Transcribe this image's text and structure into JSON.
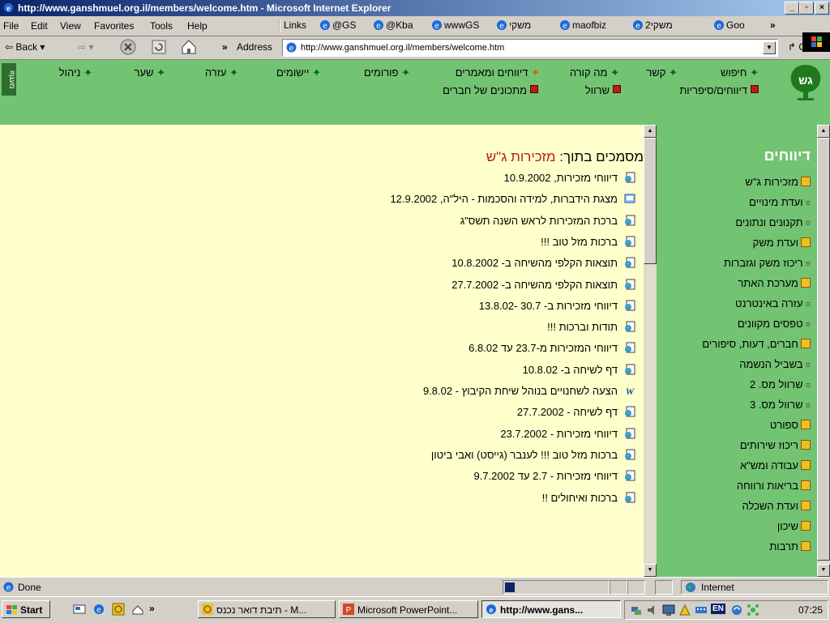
{
  "window": {
    "title": "http://www.ganshmuel.org.il/members/welcome.htm - Microsoft Internet Explorer",
    "controls": [
      "_",
      "▫",
      "×"
    ]
  },
  "menu": {
    "items": [
      "File",
      "Edit",
      "View",
      "Favorites",
      "Tools",
      "Help"
    ],
    "links_label": "Links",
    "links": [
      "@GS",
      "@Kba",
      "wwwGS",
      "משקי",
      "maofbiz",
      "2משקי",
      "Goo"
    ],
    "more": "»"
  },
  "navbar": {
    "back": "Back",
    "more": "»",
    "address_label": "Address",
    "url": "http://www.ganshmuel.org.il/members/welcome.htm",
    "go": "Go"
  },
  "site_nav": {
    "hash_label": "#מעגן",
    "row1": [
      "חיפוש",
      "קשר",
      "מה קורה",
      "דיווחים ומאמרים",
      "פורומים",
      "יישומים",
      "עזרה",
      "שער",
      "ניהול"
    ],
    "row2": [
      "דיווחים/סיפריות",
      "שרוול",
      "מתכונים של חברים"
    ]
  },
  "sidebar": {
    "title": "דיווחים",
    "items": [
      {
        "label": "מזכירות ג\"ש",
        "type": "folder"
      },
      {
        "label": "ועדת מינויים",
        "type": "sub"
      },
      {
        "label": "תקנונים ונתונים",
        "type": "sub"
      },
      {
        "label": "ועדת משק",
        "type": "folder"
      },
      {
        "label": "ריכוז משק וגזברות",
        "type": "sub"
      },
      {
        "label": "מערכת האתר",
        "type": "folder"
      },
      {
        "label": "עזרה באינטרנט",
        "type": "sub"
      },
      {
        "label": "טפסים מקוונים",
        "type": "sub"
      },
      {
        "label": "חברים, דעות, סיפורים",
        "type": "folder"
      },
      {
        "label": "בשביל הנשמה",
        "type": "sub"
      },
      {
        "label": "שרוול מס. 2",
        "type": "sub"
      },
      {
        "label": "שרוול מס. 3",
        "type": "sub"
      },
      {
        "label": "ספורט",
        "type": "folder"
      },
      {
        "label": "ריכוז שירותים",
        "type": "folder"
      },
      {
        "label": "עבודה ומש\"א",
        "type": "folder"
      },
      {
        "label": "בריאות ורווחה",
        "type": "folder"
      },
      {
        "label": "ועדת השכלה",
        "type": "folder"
      },
      {
        "label": "שיכון",
        "type": "folder"
      },
      {
        "label": "תרבות",
        "type": "folder"
      }
    ]
  },
  "main": {
    "heading_prefix": "מסמכים בתוך:",
    "heading_folder": "מזכירות ג\"ש",
    "documents": [
      {
        "label": "דיווחי מזכירות, 10.9.2002",
        "icon": "doc-icon"
      },
      {
        "label": "מצגת הידברות, למידה והסכמות - היל\"ה, 12.9.2002",
        "icon": "presentation-icon"
      },
      {
        "label": "ברכת המזכירות לראש השנה תשס\"ג",
        "icon": "doc-icon"
      },
      {
        "label": "ברכות מזל טוב !!!",
        "icon": "doc-icon"
      },
      {
        "label": "תוצאות הקלפי מהשיחה ב- 10.8.2002",
        "icon": "doc-icon"
      },
      {
        "label": "תוצאות הקלפי מהשיחה ב- 27.7.2002",
        "icon": "doc-icon"
      },
      {
        "label": "דיווחי מזכירות ב- 30.7 -13.8.02",
        "icon": "doc-icon"
      },
      {
        "label": "תודות וברכות !!!",
        "icon": "doc-icon"
      },
      {
        "label": "דיווחי המזכירות מ-23.7 עד 6.8.02",
        "icon": "doc-icon"
      },
      {
        "label": "דף לשיחה ב- 10.8.02",
        "icon": "doc-icon"
      },
      {
        "label": "הצעה לשחנויים בנוהל שיחת הקיבוץ - 9.8.02",
        "icon": "word-icon"
      },
      {
        "label": "דף לשיחה - 27.7.2002",
        "icon": "doc-icon"
      },
      {
        "label": "דיווחי מזכירות - 23.7.2002",
        "icon": "doc-icon"
      },
      {
        "label": "ברכות מזל טוב !!! לענבר (גייסט) ואבי ביטון",
        "icon": "doc-icon"
      },
      {
        "label": "דיווחי מזכירות - 2.7 עד 9.7.2002",
        "icon": "doc-icon"
      },
      {
        "label": "ברכות ואיחולים !!",
        "icon": "doc-icon"
      }
    ]
  },
  "status": {
    "text": "Done",
    "zone": "Internet"
  },
  "taskbar": {
    "start": "Start",
    "more": "»",
    "tasks": [
      {
        "label": "תיבת דואר נכנס - M...",
        "active": false
      },
      {
        "label": "Microsoft PowerPoint...",
        "active": false
      },
      {
        "label": "http://www.gans...",
        "active": true
      }
    ],
    "lang": "EN",
    "clock": "07:25"
  },
  "colors": {
    "site_green": "#72c472",
    "content_bg": "#ffffcc",
    "accent_red": "#b41e1e",
    "folder_yellow": "#f0c020"
  }
}
